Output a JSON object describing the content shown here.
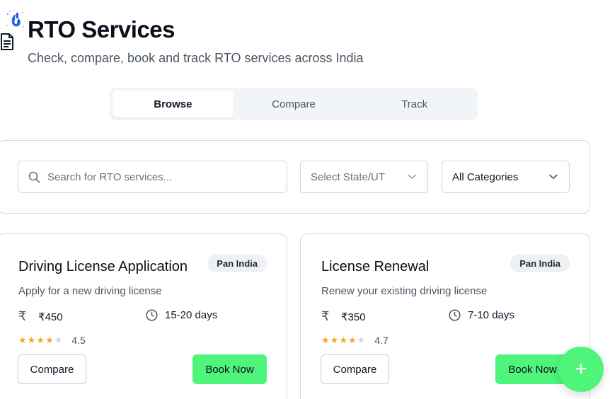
{
  "header": {
    "title": "RTO Services",
    "subtitle": "Check, compare, book and track RTO services across India"
  },
  "tabs": [
    {
      "label": "Browse",
      "active": true
    },
    {
      "label": "Compare",
      "active": false
    },
    {
      "label": "Track",
      "active": false
    }
  ],
  "filters": {
    "search_placeholder": "Search for RTO services...",
    "state_placeholder": "Select State/UT",
    "category_value": "All Categories"
  },
  "services": [
    {
      "title": "Driving License Application",
      "badge": "Pan India",
      "description": "Apply for a new driving license",
      "price": "₹450",
      "duration": "15-20 days",
      "rating": "4.5",
      "stars_filled": 4,
      "compare_label": "Compare",
      "book_label": "Book Now"
    },
    {
      "title": "License Renewal",
      "badge": "Pan India",
      "description": "Renew your existing driving license",
      "price": "₹350",
      "duration": "7-10 days",
      "rating": "4.7",
      "stars_filled": 4,
      "compare_label": "Compare",
      "book_label": "Book Now"
    }
  ],
  "icons": {
    "rupee": "₹",
    "star": "★",
    "fab": "+"
  },
  "colors": {
    "accent": "#4ef57a",
    "star": "#f5a524",
    "tab_bg": "#f1f4f8"
  }
}
